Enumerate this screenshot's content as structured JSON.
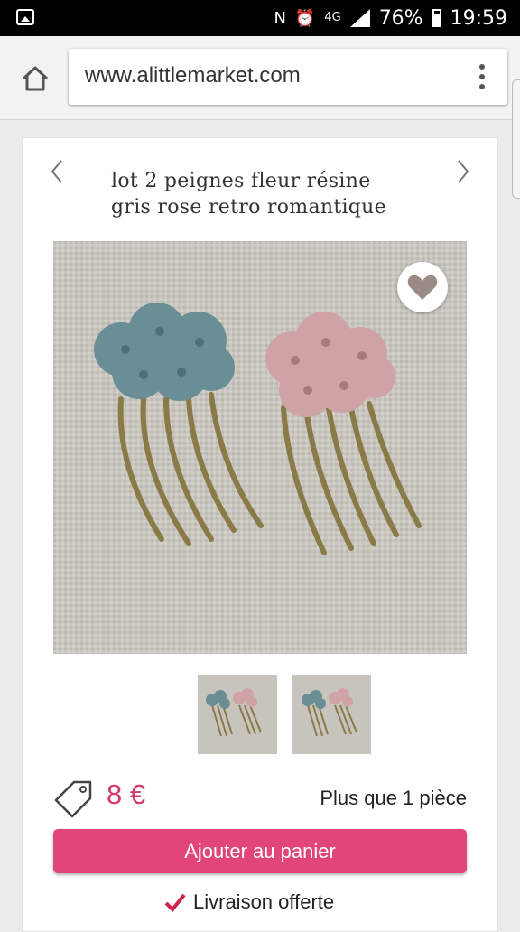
{
  "status_bar": {
    "battery": "76%",
    "time": "19:59",
    "network": "4G",
    "icons": [
      "screenshot-icon",
      "nfc-icon",
      "alarm-icon",
      "4g-icon",
      "signal-icon",
      "battery-icon"
    ]
  },
  "browser": {
    "url": "www.alittlemarket.com",
    "icons": [
      "home-icon",
      "overflow-menu-icon"
    ]
  },
  "product": {
    "title_line1": "lot 2 peignes fleur résine",
    "title_line2": "gris rose retro romantique",
    "price": "8 €",
    "stock": "Plus que 1 pièce",
    "add_to_cart_label": "Ajouter au panier",
    "delivery": "Livraison offerte",
    "image_colors": {
      "blue_flower": "#6a8e96",
      "pink_flower": "#cfa3a6",
      "metal": "#8a7a48",
      "background": "#c7c3bd"
    },
    "accent_color": "#e2457a",
    "price_color": "#d4366d"
  }
}
